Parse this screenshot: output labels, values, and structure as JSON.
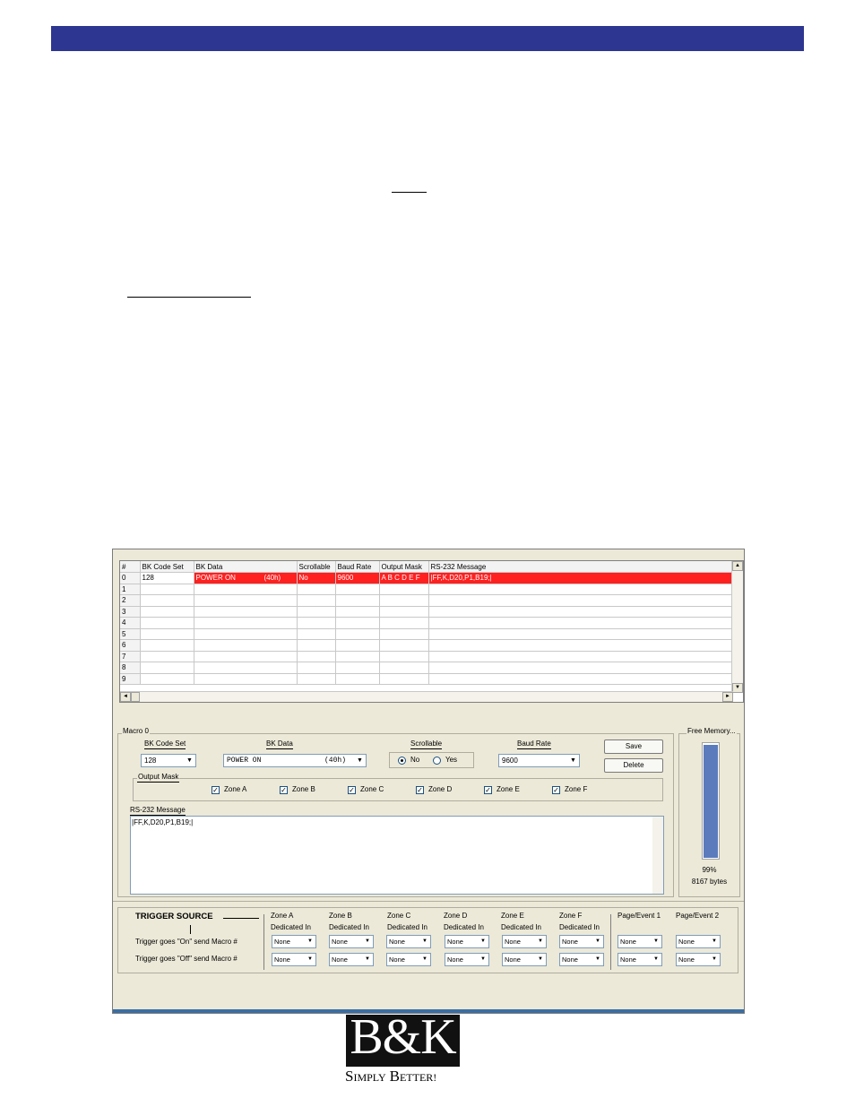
{
  "grid": {
    "headers": [
      "#",
      "BK Code Set",
      "BK Data",
      "Scrollable",
      "Baud Rate",
      "Output Mask",
      "RS-232 Message"
    ],
    "rows": [
      {
        "num": "0",
        "code_set": "128",
        "bk_data": "POWER ON",
        "hex": "(40h)",
        "scrollable": "No",
        "baud": "9600",
        "mask": "A B C D E F",
        "message": "|FF,K,D20,P1,B19;|"
      },
      {
        "num": "1"
      },
      {
        "num": "2"
      },
      {
        "num": "3"
      },
      {
        "num": "4"
      },
      {
        "num": "5"
      },
      {
        "num": "6"
      },
      {
        "num": "7"
      },
      {
        "num": "8"
      },
      {
        "num": "9"
      }
    ],
    "scroll_up": "▲",
    "scroll_down": "▼",
    "scroll_left": "◄",
    "scroll_right": "►"
  },
  "macro": {
    "group_title": "Macro 0",
    "code_set_label": "BK Code Set",
    "code_set_value": "128",
    "bk_data_label": "BK Data",
    "bk_data_value": "POWER ON",
    "bk_data_hex": "(40h)",
    "scrollable_label": "Scrollable",
    "scrollable_no": "No",
    "scrollable_yes": "Yes",
    "scrollable_selected": "No",
    "baud_label": "Baud Rate",
    "baud_value": "9600",
    "save_label": "Save",
    "delete_label": "Delete",
    "output_mask_label": "Output Mask",
    "zones": [
      {
        "label": "Zone A",
        "checked": true
      },
      {
        "label": "Zone B",
        "checked": true
      },
      {
        "label": "Zone C",
        "checked": true
      },
      {
        "label": "Zone D",
        "checked": true
      },
      {
        "label": "Zone E",
        "checked": true
      },
      {
        "label": "Zone F",
        "checked": true
      }
    ],
    "rs232_label": "RS-232 Message",
    "rs232_value": "|FF,K,D20,P1,B19;|",
    "check_mark": "✓",
    "dropdown_arrow": "▼"
  },
  "memory": {
    "title": "Free Memory...",
    "percent_text": "99%",
    "fill_fraction": 0.99,
    "bytes_text": "8167 bytes",
    "bar_color": "#5b7bbd"
  },
  "trigger": {
    "title": "TRIGGER SOURCE",
    "on_label": "Trigger goes \"On\" send Macro #",
    "off_label": "Trigger goes \"Off\" send Macro #",
    "columns": [
      {
        "line1": "Zone A",
        "line2": "Dedicated In"
      },
      {
        "line1": "Zone B",
        "line2": "Dedicated In"
      },
      {
        "line1": "Zone C",
        "line2": "Dedicated In"
      },
      {
        "line1": "Zone D",
        "line2": "Dedicated In"
      },
      {
        "line1": "Zone E",
        "line2": "Dedicated In"
      },
      {
        "line1": "Zone F",
        "line2": "Dedicated In"
      },
      {
        "line1": "Page/Event 1",
        "line2": ""
      },
      {
        "line1": "Page/Event 2",
        "line2": ""
      }
    ],
    "none_value": "None"
  },
  "branding": {
    "logo": "B&K",
    "slogan_s": "S",
    "slogan_imply": "IMPLY",
    "slogan_b": "B",
    "slogan_etter": "ETTER!",
    "header_bar_color": "#2d3690"
  }
}
